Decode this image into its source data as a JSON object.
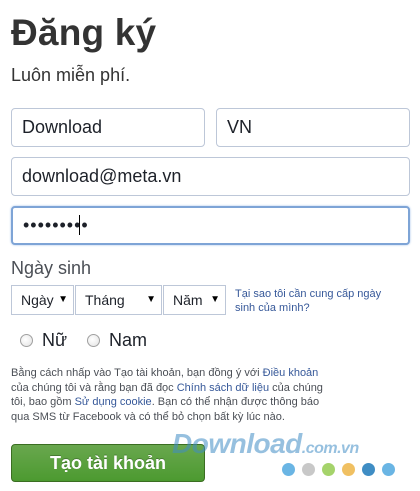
{
  "header": {
    "title": "Đăng ký",
    "subtitle": "Luôn miễn phí."
  },
  "form": {
    "first_name": "Download",
    "last_name": "VN",
    "email": "download@meta.vn",
    "password_mask": "•••••••••"
  },
  "birthday": {
    "label": "Ngày sinh",
    "day": "Ngày",
    "month": "Tháng",
    "year": "Năm",
    "why_link": "Tại sao tôi cần cung cấp ngày sinh của mình?"
  },
  "gender": {
    "female": "Nữ",
    "male": "Nam"
  },
  "terms": {
    "part1": "Bằng cách nhấp vào Tạo tài khoản, bạn đồng ý với ",
    "link_terms": "Điều khoản",
    "part2": " của chúng tôi và rằng bạn đã đọc ",
    "link_data": "Chính sách dữ liệu",
    "part3": " của chúng tôi, bao gồm ",
    "link_cookie": "Sử dụng cookie",
    "part4": ". Bạn có thể nhận được thông báo qua SMS từ Facebook và có thể bỏ chọn bất kỳ lúc nào."
  },
  "submit_label": "Tạo tài khoản",
  "watermark": {
    "main": "Download",
    "suffix": ".com.vn"
  },
  "colors": {
    "button": "#4c9a30",
    "link": "#365899",
    "dots": [
      "#6ab5e4",
      "#c8c8c8",
      "#a5d36b",
      "#f0c062",
      "#3f8dc4",
      "#6ab5e4"
    ]
  }
}
